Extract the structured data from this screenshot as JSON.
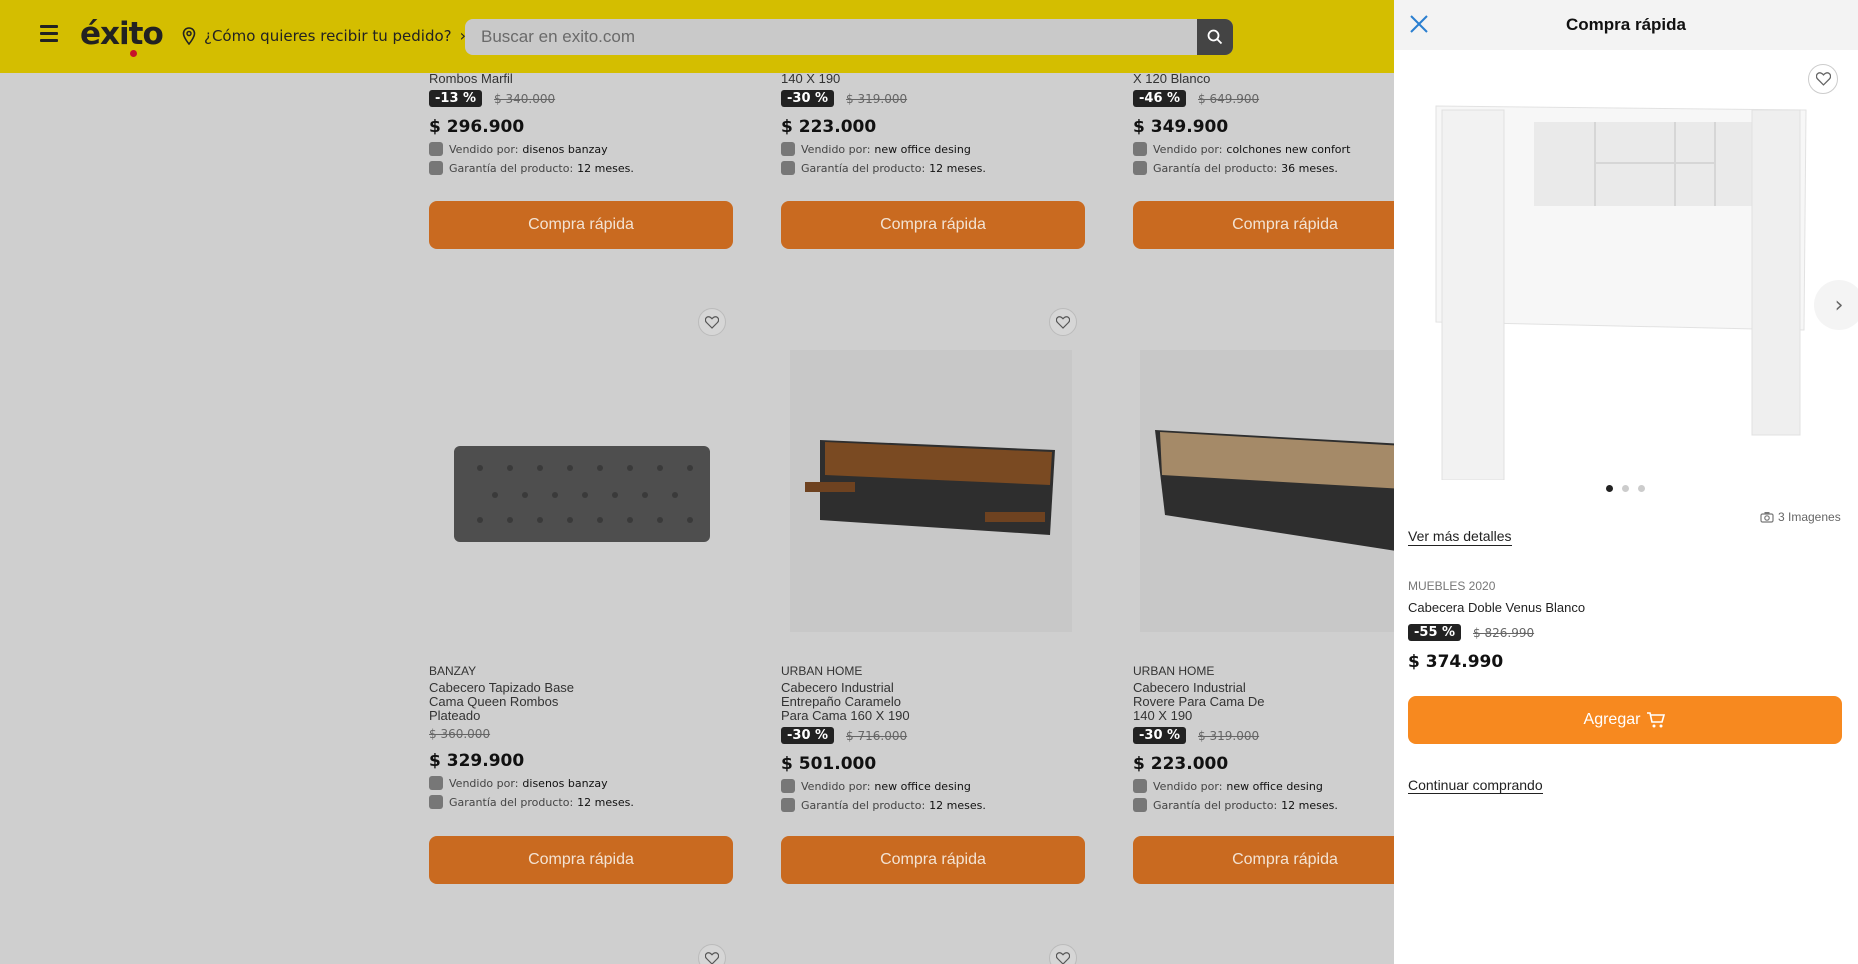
{
  "header": {
    "logo_text": "éxito",
    "location_text": "¿Cómo quieres recibir tu pedido?",
    "search_placeholder": "Buscar en exito.com"
  },
  "products_row1": [
    {
      "name_tail": "Rombos Marfil",
      "discount": "-13 %",
      "old_price": "$ 340.000",
      "price": "$ 296.900",
      "seller_label": "Vendido por:",
      "seller": "disenos banzay",
      "warranty_label": "Garantía del producto:",
      "warranty": "12 meses.",
      "button": "Compra rápida"
    },
    {
      "name_tail": "140 X 190",
      "discount": "-30 %",
      "old_price": "$ 319.000",
      "price": "$ 223.000",
      "seller_label": "Vendido por:",
      "seller": "new office desing",
      "warranty_label": "Garantía del producto:",
      "warranty": "12 meses.",
      "button": "Compra rápida"
    },
    {
      "name_tail": "X 120 Blanco",
      "discount": "-46 %",
      "old_price": "$ 649.900",
      "price": "$ 349.900",
      "seller_label": "Vendido por:",
      "seller": "colchones new confort",
      "warranty_label": "Garantía del producto:",
      "warranty": "36 meses.",
      "button": "Compra rápida"
    }
  ],
  "products_row2": [
    {
      "brand": "BANZAY",
      "name1": "Cabecero Tapizado Base",
      "name2": "Cama Queen Rombos",
      "name3": "Plateado",
      "discount": "",
      "old_price": "$ 360.000",
      "price": "$ 329.900",
      "seller_label": "Vendido por:",
      "seller": "disenos banzay",
      "warranty_label": "Garantía del producto:",
      "warranty": "12 meses.",
      "button": "Compra rápida"
    },
    {
      "brand": "URBAN HOME",
      "name1": "Cabecero Industrial",
      "name2": "Entrepaño Caramelo",
      "name3": "Para Cama 160 X 190",
      "discount": "-30 %",
      "old_price": "$ 716.000",
      "price": "$ 501.000",
      "seller_label": "Vendido por:",
      "seller": "new office desing",
      "warranty_label": "Garantía del producto:",
      "warranty": "12 meses.",
      "button": "Compra rápida"
    },
    {
      "brand": "URBAN HOME",
      "name1": "Cabecero Industrial",
      "name2": "Rovere Para Cama De",
      "name3": "140 X 190",
      "discount": "-30 %",
      "old_price": "$ 319.000",
      "price": "$ 223.000",
      "seller_label": "Vendido por:",
      "seller": "new office desing",
      "warranty_label": "Garantía del producto:",
      "warranty": "12 meses.",
      "button": "Compra rápida"
    }
  ],
  "drawer": {
    "title": "Compra rápida",
    "image_count": "3 Imagenes",
    "ver_mas": "Ver más detalles",
    "brand": "MUEBLES 2020",
    "name": "Cabecera Doble Venus Blanco",
    "discount": "-55 %",
    "old_price": "$ 826.990",
    "price": "$ 374.990",
    "add_button": "Agregar",
    "continue_link": "Continuar comprando"
  },
  "colors": {
    "header_bg": "#d4be00",
    "button_orange_dim": "#c96a20",
    "button_orange": "#f7891f",
    "badge_bg": "#222222"
  }
}
